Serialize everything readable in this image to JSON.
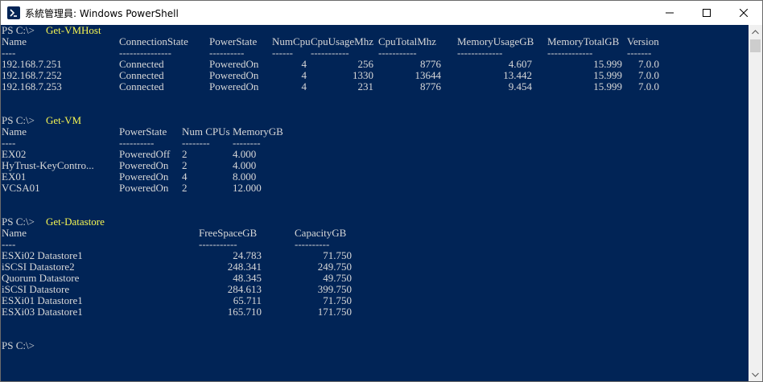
{
  "window": {
    "title": "系統管理員: Windows PowerShell"
  },
  "host": {
    "prompt": "PS C:\\>",
    "command": "Get-VMHost",
    "headers": [
      "Name",
      "ConnectionState",
      "PowerState",
      "NumCpu",
      "CpuUsageMhz",
      "CpuTotalMhz",
      "MemoryUsageGB",
      "MemoryTotalGB",
      "Version"
    ],
    "dashes": [
      "----",
      "---------------",
      "----------",
      "------",
      "-----------",
      "-----------",
      "-------------",
      "-------------",
      "-------"
    ],
    "rows": [
      [
        "192.168.7.251",
        "Connected",
        "PoweredOn",
        "4",
        "256",
        "8776",
        "4.607",
        "15.999",
        "7.0.0"
      ],
      [
        "192.168.7.252",
        "Connected",
        "PoweredOn",
        "4",
        "1330",
        "13644",
        "13.442",
        "15.999",
        "7.0.0"
      ],
      [
        "192.168.7.253",
        "Connected",
        "PoweredOn",
        "4",
        "231",
        "8776",
        "9.454",
        "15.999",
        "7.0.0"
      ]
    ]
  },
  "vm": {
    "prompt": "PS C:\\>",
    "command": "Get-VM",
    "headers": [
      "Name",
      "PowerState",
      "Num CPUs",
      "MemoryGB"
    ],
    "dashes": [
      "----",
      "----------",
      "--------",
      "--------"
    ],
    "rows": [
      [
        "EX02",
        "PoweredOff",
        "2",
        "4.000"
      ],
      [
        "HyTrust-KeyContro...",
        "PoweredOn",
        "2",
        "4.000"
      ],
      [
        "EX01",
        "PoweredOn",
        "4",
        "8.000"
      ],
      [
        "VCSA01",
        "PoweredOn",
        "2",
        "12.000"
      ]
    ]
  },
  "datastore": {
    "prompt": "PS C:\\>",
    "command": "Get-Datastore",
    "headers": [
      "Name",
      "FreeSpaceGB",
      "CapacityGB"
    ],
    "dashes": [
      "----",
      "-----------",
      "----------"
    ],
    "rows": [
      [
        "ESXi02 Datastore1",
        "24.783",
        "71.750"
      ],
      [
        "iSCSI Datastore2",
        "248.341",
        "249.750"
      ],
      [
        "Quorum Datastore",
        "48.345",
        "49.750"
      ],
      [
        "iSCSI Datastore",
        "284.613",
        "399.750"
      ],
      [
        "ESXi01 Datastore1",
        "65.711",
        "71.750"
      ],
      [
        "ESXi03 Datastore1",
        "165.710",
        "171.750"
      ]
    ]
  },
  "final_prompt": "PS C:\\>"
}
